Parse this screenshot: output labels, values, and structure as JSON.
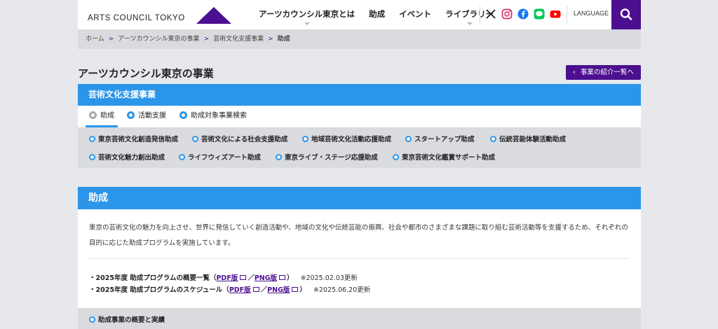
{
  "logo": {
    "text": "ARTS COUNCIL TOKYO",
    "accent": "#4b0f8f"
  },
  "nav": [
    "アーツカウンシル東京とは",
    "助成",
    "イベント",
    "ライブラリー"
  ],
  "language_label": "LANGUAGE",
  "breadcrumb": {
    "items": [
      "ホーム",
      "アーツカウンシル東京の事業",
      "芸術文化支援事業"
    ],
    "current": "助成",
    "separator": ">"
  },
  "section_title": "アーツカウンシル東京の事業",
  "back_button": "事業の紹介一覧へ",
  "support": {
    "title": "芸術文化支援事業",
    "tabs": [
      "助成",
      "活動支援",
      "助成対象事業検索"
    ],
    "sub_row1": [
      "東京芸術文化創造発信助成",
      "芸術文化による社会支援助成",
      "地域芸術文化活動応援助成",
      "スタートアップ助成",
      "伝統芸能体験活動助成"
    ],
    "sub_row2": [
      "芸術文化魅力創出助成",
      "ライフウィズアート助成",
      "東京ライブ・ステージ応援助成",
      "東京芸術文化鑑賞サポート助成"
    ]
  },
  "grant": {
    "title": "助成",
    "description": "東京の芸術文化の魅力を向上させ、世界に発信していく創造活動や、地域の文化や伝統芸能の振興、社会や都市のさまざまな課題に取り組む芸術活動等を支援するため、それぞれの目的に応じた助成プログラムを実施しています。",
    "items": [
      {
        "prefix": "・2025年度 助成プログラムの概要一覧（",
        "pdf": "PDF版",
        "slash": "／",
        "png": "PNG版",
        "suffix": "）",
        "updated": "※2025.02.03更新"
      },
      {
        "prefix": "・2025年度 助成プログラムのスケジュール（",
        "pdf": "PDF版",
        "slash": "／",
        "png": "PNG版",
        "suffix": "）",
        "updated": "※2025.06.20更新"
      }
    ],
    "overview_label": "助成事業の概要と実績"
  },
  "colors": {
    "blue": "#2b95e9",
    "purple": "#4b0f8f",
    "gray_bg": "#e6e8ec"
  }
}
